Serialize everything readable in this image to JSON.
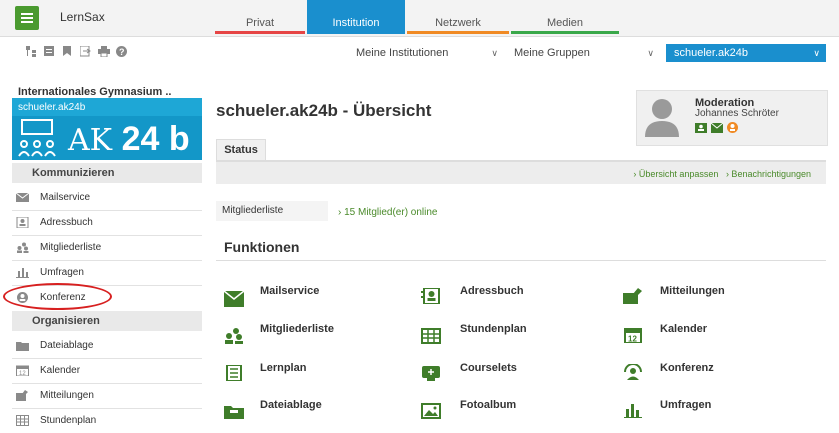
{
  "app": {
    "name": "LernSax"
  },
  "tabs": [
    {
      "label": "Privat",
      "color": "#e64545",
      "active": false
    },
    {
      "label": "Institution",
      "color": "#1a8fce",
      "active": true
    },
    {
      "label": "Netzwerk",
      "color": "#f08a24",
      "active": false
    },
    {
      "label": "Medien",
      "color": "#3aa84a",
      "active": false
    }
  ],
  "toolbar_icons": [
    "sitemap-icon",
    "notes-icon",
    "bookmark-icon",
    "logout-icon",
    "print-icon",
    "help-icon"
  ],
  "selects": {
    "institutions": "Meine Institutionen",
    "groups": "Meine Gruppen",
    "current": "schueler.ak24b"
  },
  "sidebar": {
    "institution": "Internationales Gymnasium ..",
    "group_name": "schueler.ak24b",
    "banner_text": "AK",
    "banner_bold": "24 b",
    "section_kommunizieren": "Kommunizieren",
    "items_kommunizieren": [
      {
        "label": "Mailservice",
        "icon": "mail-icon"
      },
      {
        "label": "Adressbuch",
        "icon": "addressbook-icon"
      },
      {
        "label": "Mitgliederliste",
        "icon": "members-icon"
      },
      {
        "label": "Umfragen",
        "icon": "poll-icon"
      },
      {
        "label": "Konferenz",
        "icon": "conference-icon"
      }
    ],
    "section_organisieren": "Organisieren",
    "items_organisieren": [
      {
        "label": "Dateiablage",
        "icon": "folder-icon"
      },
      {
        "label": "Kalender",
        "icon": "calendar-icon"
      },
      {
        "label": "Mitteilungen",
        "icon": "notes-icon"
      },
      {
        "label": "Stundenplan",
        "icon": "timetable-icon"
      }
    ]
  },
  "main": {
    "title": "schueler.ak24b - Übersicht",
    "moderation_label": "Moderation",
    "moderator": "Johannes Schröter",
    "status_tab": "Status",
    "link_overview": "› Übersicht anpassen",
    "link_notify": "› Benachrichtigungen",
    "members_label": "Mitgliederliste",
    "members_value": "› 15 Mitglied(er) online",
    "functions_title": "Funktionen",
    "functions": [
      {
        "label": "Mailservice",
        "icon": "mail-icon"
      },
      {
        "label": "Adressbuch",
        "icon": "addressbook-icon"
      },
      {
        "label": "Mitteilungen",
        "icon": "notes-icon"
      },
      {
        "label": "Mitgliederliste",
        "icon": "members-icon"
      },
      {
        "label": "Stundenplan",
        "icon": "timetable-icon"
      },
      {
        "label": "Kalender",
        "icon": "calendar-icon"
      },
      {
        "label": "Lernplan",
        "icon": "learnplan-icon"
      },
      {
        "label": "Courselets",
        "icon": "courselets-icon"
      },
      {
        "label": "Konferenz",
        "icon": "conference-icon"
      },
      {
        "label": "Dateiablage",
        "icon": "folder-icon"
      },
      {
        "label": "Fotoalbum",
        "icon": "photo-icon"
      },
      {
        "label": "Umfragen",
        "icon": "poll-icon"
      }
    ]
  },
  "colors": {
    "green": "#3f7d2a",
    "blue": "#1a8fce",
    "highlight": "#d72020"
  }
}
